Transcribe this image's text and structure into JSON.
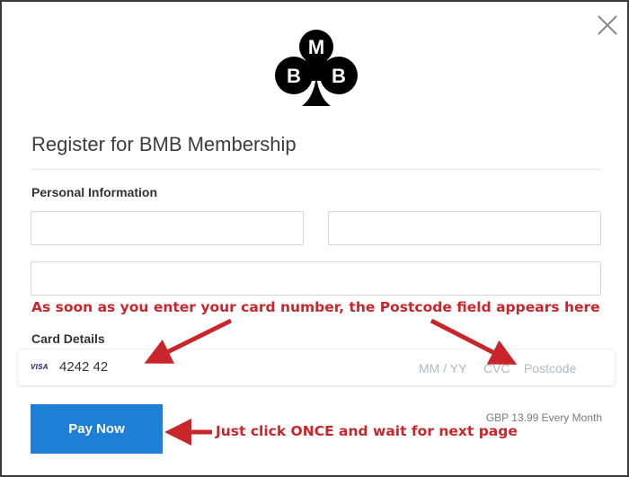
{
  "modal": {
    "title": "Register for BMB Membership",
    "close_icon": "close-icon",
    "logo_icon": "bmb-club-logo-icon"
  },
  "personal": {
    "heading": "Personal Information",
    "field1_value": "",
    "field2_value": "",
    "field3_value": ""
  },
  "card": {
    "heading": "Card Details",
    "brand": "VISA",
    "number": "4242 42",
    "expiry_placeholder": "MM / YY",
    "cvc_placeholder": "CVC",
    "postcode_placeholder": "Postcode"
  },
  "payment": {
    "button_label": "Pay Now",
    "price": "GBP 13.99 Every Month"
  },
  "annotations": {
    "postcode_note": "As soon as you enter your card number, the Postcode field appears here",
    "click_note": "Just click ONCE and wait for next page",
    "color": "#c8262b"
  },
  "colors": {
    "accent": "#1e7fd6",
    "annotation": "#c8262b"
  }
}
